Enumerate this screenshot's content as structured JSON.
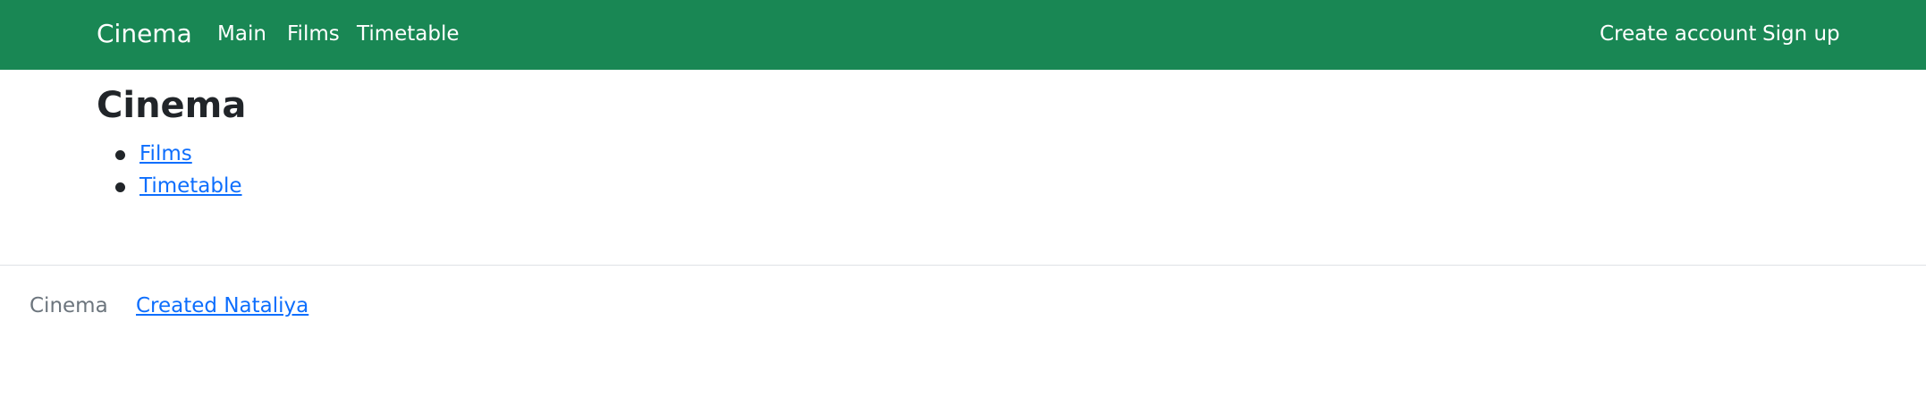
{
  "navbar": {
    "brand": "Cinema",
    "left_links": [
      "Main",
      "Films",
      "Timetable"
    ],
    "right_links": [
      "Create account",
      "Sign up"
    ],
    "background_color": "#198754"
  },
  "main": {
    "title": "Cinema",
    "links": [
      "Films",
      "Timetable"
    ]
  },
  "footer": {
    "brand": "Cinema",
    "credit": "Created Nataliya"
  },
  "colors": {
    "link": "#0d6efd",
    "muted": "#6c757d",
    "text": "#212529"
  }
}
